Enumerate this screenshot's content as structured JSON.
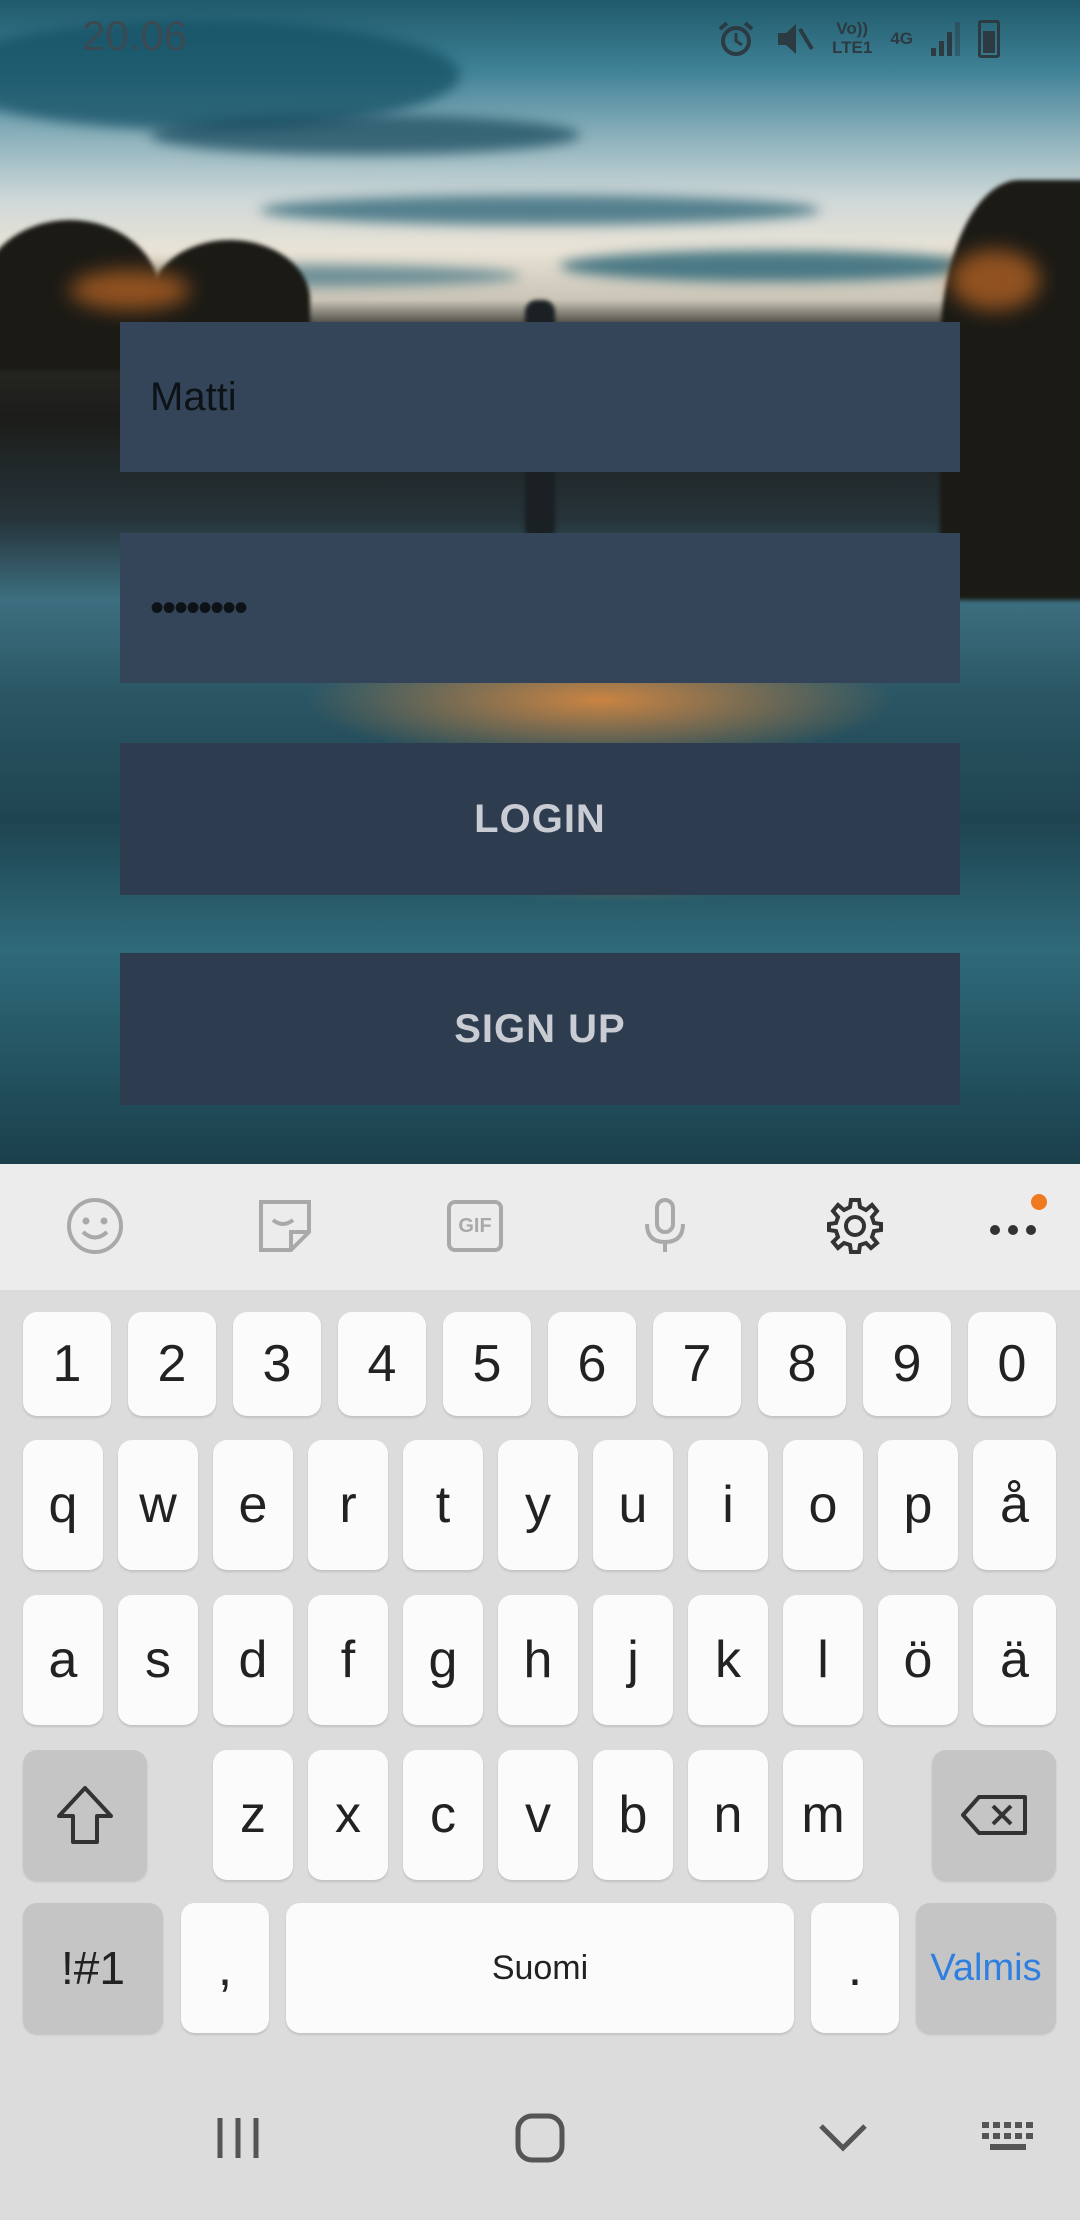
{
  "status_bar": {
    "time": "20.06",
    "volte_label": "Vo))\nLTE1",
    "network_label": "4G",
    "icons": [
      "alarm-icon",
      "mute-icon",
      "volte-icon",
      "4g-icon",
      "signal-icon",
      "battery-icon"
    ]
  },
  "login": {
    "username_value": "Matti",
    "password_value": "••••••••",
    "login_label": "LOGIN",
    "signup_label": "SIGN UP"
  },
  "keyboard": {
    "toolbar_icons": [
      "emoji-icon",
      "sticker-icon",
      "gif-icon",
      "microphone-icon",
      "settings-icon",
      "more-icon"
    ],
    "gif_label": "GIF",
    "number_row": [
      "1",
      "2",
      "3",
      "4",
      "5",
      "6",
      "7",
      "8",
      "9",
      "0"
    ],
    "row1": [
      "q",
      "w",
      "e",
      "r",
      "t",
      "y",
      "u",
      "i",
      "o",
      "p",
      "å"
    ],
    "row2": [
      "a",
      "s",
      "d",
      "f",
      "g",
      "h",
      "j",
      "k",
      "l",
      "ö",
      "ä"
    ],
    "row3": [
      "z",
      "x",
      "c",
      "v",
      "b",
      "n",
      "m"
    ],
    "symbols_label": "!#1",
    "comma_label": ",",
    "space_label": "Suomi",
    "period_label": ".",
    "done_label": "Valmis",
    "accent_color": "#2f7fe0",
    "notification_dot_color": "#f07a20"
  },
  "nav_bar": {
    "icons": [
      "recents-icon",
      "home-icon",
      "back-icon",
      "keyboard-switch-icon"
    ]
  }
}
